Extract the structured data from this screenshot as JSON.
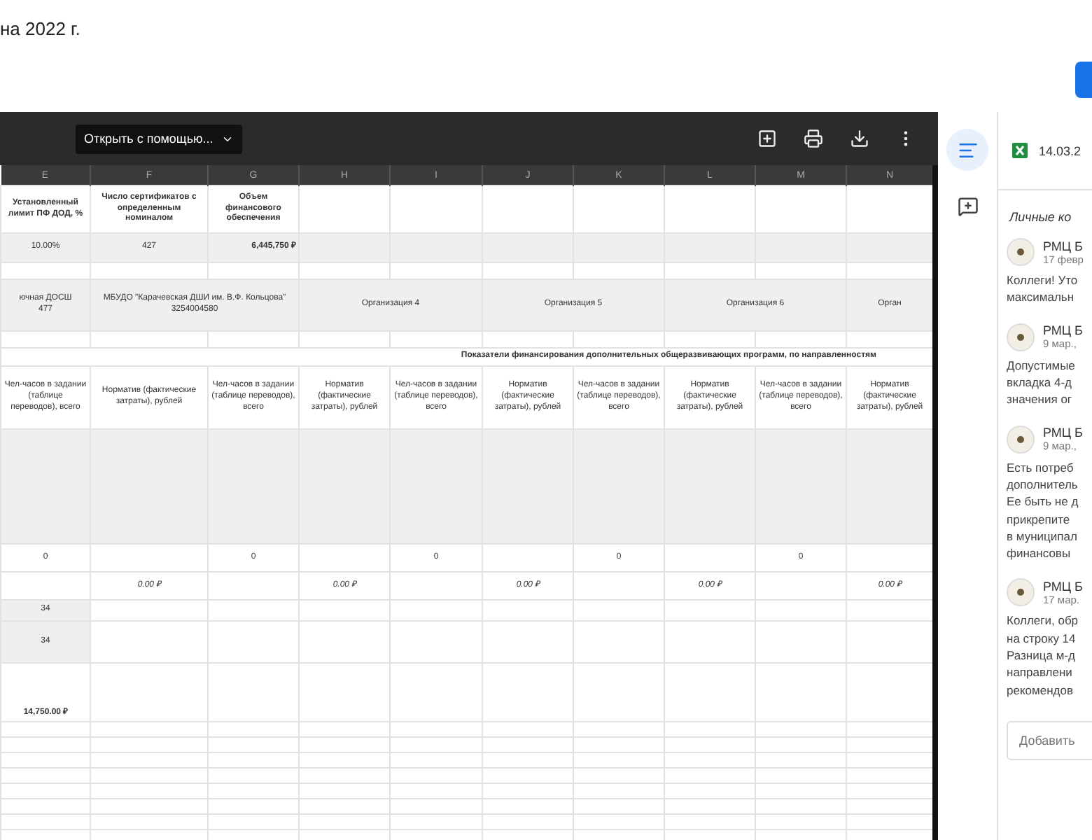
{
  "page_title": "на 2022 г.",
  "viewer": {
    "open_with": "Открыть с помощью...",
    "columns": [
      "E",
      "F",
      "G",
      "H",
      "I",
      "J",
      "K",
      "L",
      "M",
      "N"
    ]
  },
  "sheet": {
    "rows": [
      {
        "kind": "header",
        "cells": [
          {
            "text": "Установленный лимит ПФ ДОД, %",
            "bold": true
          },
          {
            "text": "Число сертификатов с определенным номиналом",
            "bold": true
          },
          {
            "text": "Объем финансового обеспечения",
            "bold": true
          }
        ]
      },
      {
        "kind": "values",
        "cells": [
          {
            "text": "10.00%"
          },
          {
            "text": "427"
          },
          {
            "text": "6,445,750 ₽",
            "bold": true
          }
        ]
      },
      {
        "kind": "blank"
      },
      {
        "kind": "orgs",
        "cells": [
          {
            "text": "ючная ДОСШ",
            "subtext": "477"
          },
          {
            "text": "МБУДО \"Карачевская ДШИ им. В.Ф. Кольцова\"",
            "subtext": "3254004580",
            "wide": true
          },
          {
            "text": "Организация 4",
            "wide": true
          },
          {
            "text": "Организация 5",
            "wide": true
          },
          {
            "text": "Организация 6",
            "wide": true
          },
          {
            "text": "Орган"
          }
        ]
      },
      {
        "kind": "blank"
      },
      {
        "kind": "section",
        "cells": [
          {
            "text": "Показатели финансирования дополнительных общеразвивающих программ, по направленностям",
            "bold": true,
            "full": true
          }
        ]
      },
      {
        "kind": "subheader",
        "cells": [
          {
            "text": "Чел-часов в задании (таблице переводов), всего"
          },
          {
            "text": "Норматив (фактические затраты), рублей"
          },
          {
            "text": "Чел-часов в задании (таблице переводов), всего"
          },
          {
            "text": "Норматив (фактические затраты), рублей"
          },
          {
            "text": "Чел-часов в задании (таблице переводов), всего"
          },
          {
            "text": "Норматив (фактические затраты), рублей"
          },
          {
            "text": "Чел-часов в задании (таблице переводов), всего"
          },
          {
            "text": "Норматив (фактические затраты), рублей"
          },
          {
            "text": "Чел-часов в задании (таблице переводов), всего"
          },
          {
            "text": "Норматив (фактические затраты), рублей"
          }
        ]
      },
      {
        "kind": "band"
      },
      {
        "kind": "numbers",
        "cells": [
          {
            "text": "0"
          },
          {},
          {
            "text": "0"
          },
          {},
          {
            "text": "0"
          },
          {},
          {
            "text": "0"
          },
          {},
          {
            "text": "0"
          }
        ]
      },
      {
        "kind": "numbers",
        "cells": [
          {},
          {
            "text": "0.00 ₽",
            "italic": true
          },
          {},
          {
            "text": "0.00 ₽",
            "italic": true
          },
          {},
          {
            "text": "0.00 ₽",
            "italic": true
          },
          {},
          {
            "text": "0.00 ₽",
            "italic": true
          },
          {},
          {
            "text": "0.00 ₽",
            "italic": true
          }
        ]
      },
      {
        "kind": "short",
        "cells": [
          {
            "text": "34"
          }
        ]
      },
      {
        "kind": "tall",
        "cells": [
          {
            "text": "34"
          }
        ]
      },
      {
        "kind": "total",
        "cells": [
          {
            "text": "14,750.00 ₽",
            "bold": true
          }
        ]
      }
    ]
  },
  "side_panel": {
    "rail": [
      {
        "kind": "details",
        "selected": true
      },
      {
        "kind": "comments",
        "selected": false
      }
    ],
    "file": {
      "name": "14.03.2"
    },
    "section": "Личные ко",
    "comments": [
      {
        "author": "РМЦ Б",
        "date": "17 февр",
        "lines": [
          "Коллеги! Уто",
          "максимальн"
        ]
      },
      {
        "author": "РМЦ Б",
        "date": "9 мар.,",
        "lines": [
          "Допустимые",
          "вкладка 4-д",
          "значения ог"
        ]
      },
      {
        "author": "РМЦ Б",
        "date": "9 мар.,",
        "lines": [
          "Есть потреб",
          "дополнитель",
          "Ее быть не д",
          "прикрепите",
          "в муниципал",
          "финансовы"
        ]
      },
      {
        "author": "РМЦ Б",
        "date": "17 мар.",
        "lines": [
          "Коллеги, обр",
          "на строку 14",
          "Разница м-д",
          "направлени",
          "рекомендов"
        ]
      }
    ],
    "reply": {
      "placeholder": "Добавить"
    }
  }
}
